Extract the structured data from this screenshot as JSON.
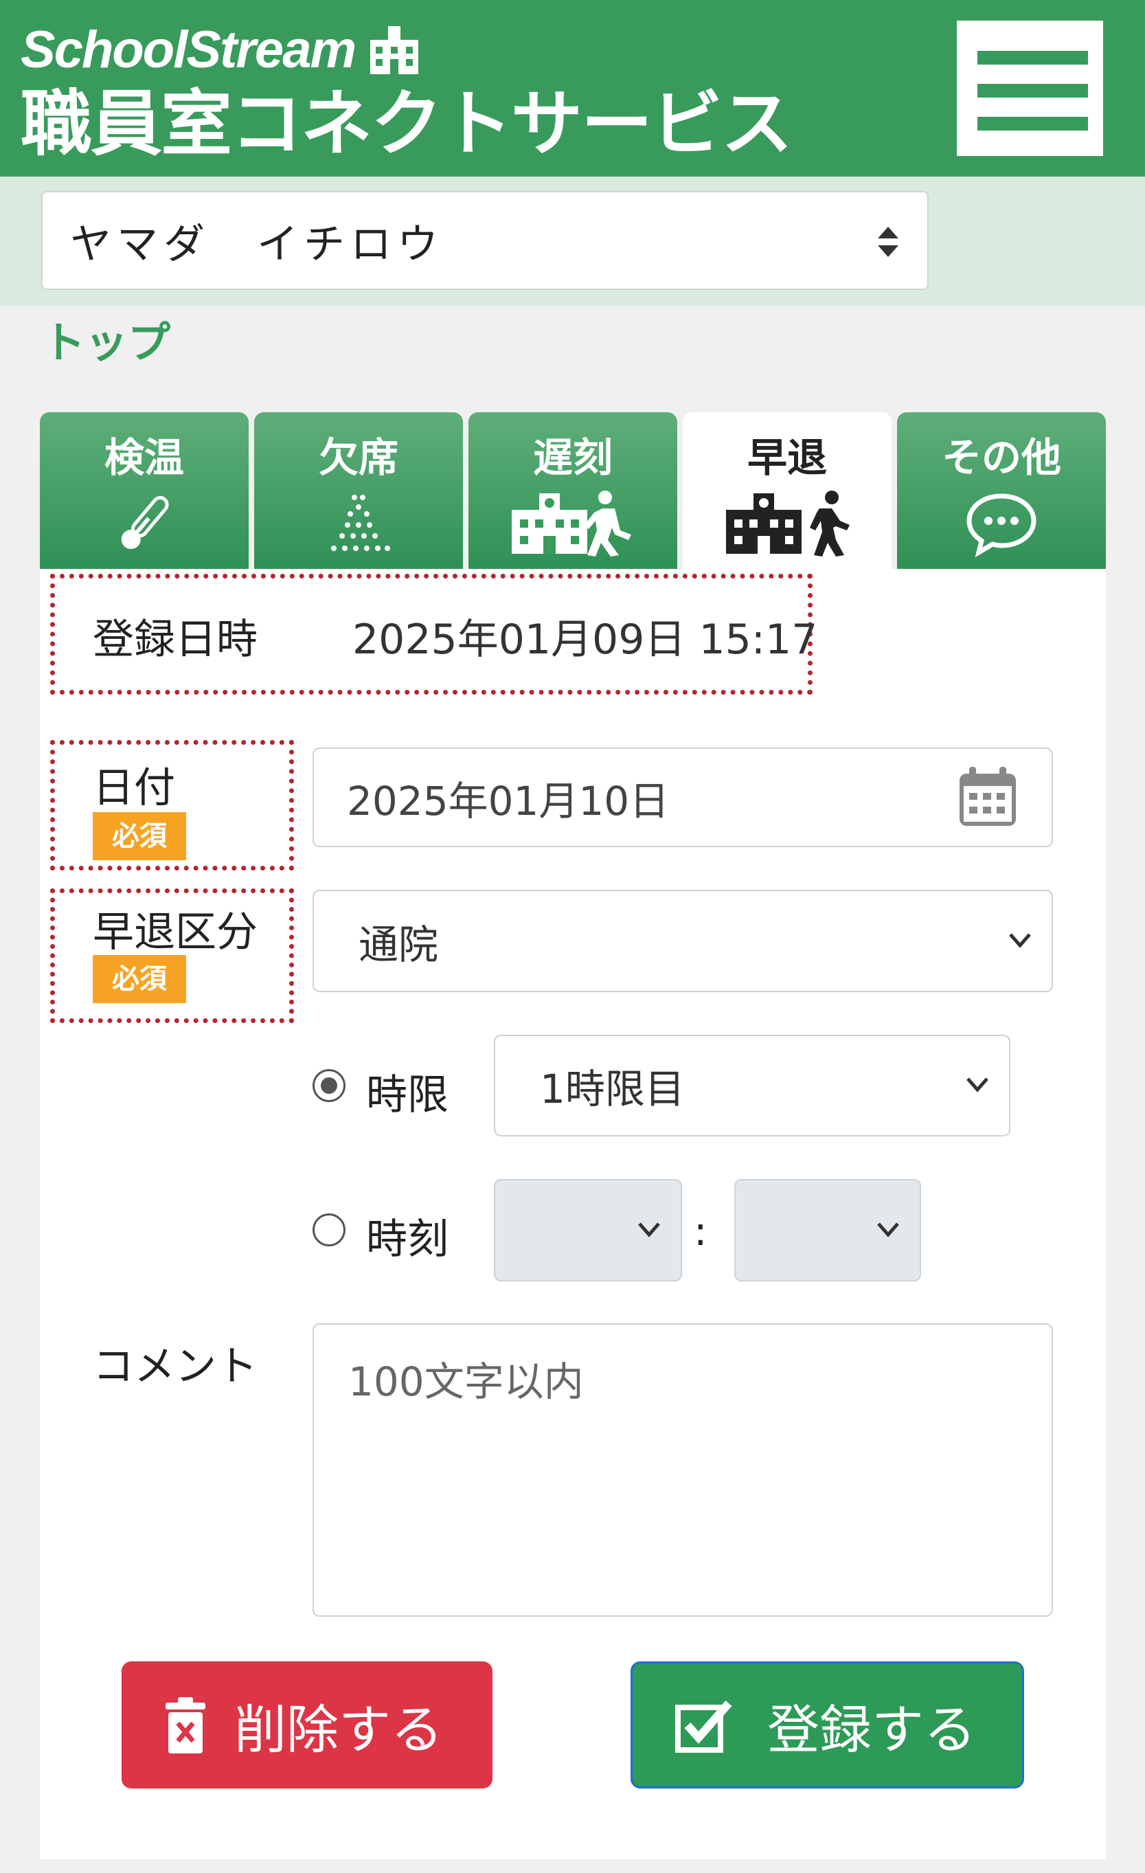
{
  "header": {
    "brand_line1": "SchoolStream",
    "brand_line2": "職員室コネクトサービス",
    "colors": {
      "brand_green": "#389b5c",
      "band_green": "#d9eadf"
    }
  },
  "student_select": {
    "value": "ヤマダ　イチロウ"
  },
  "breadcrumb": {
    "top": "トップ"
  },
  "tabs": [
    {
      "label": "検温",
      "icon": "thermometer-icon",
      "active": false
    },
    {
      "label": "欠席",
      "icon": "dots-icon",
      "active": false
    },
    {
      "label": "遅刻",
      "icon": "school-walk-in-icon",
      "active": false
    },
    {
      "label": "早退",
      "icon": "school-walk-out-icon",
      "active": true
    },
    {
      "label": "その他",
      "icon": "chat-icon",
      "active": false
    }
  ],
  "form": {
    "registered_label": "登録日時",
    "registered_value": "2025年01月09日 15:17",
    "date_label": "日付",
    "required_badge": "必須",
    "date_value": "2025年01月10日",
    "type_label": "早退区分",
    "type_value": "通院",
    "period_radio_label": "時限",
    "period_value": "1時限目",
    "period_selected": true,
    "time_radio_label": "時刻",
    "time_colon": ":",
    "comment_label": "コメント",
    "comment_placeholder": "100文字以内"
  },
  "actions": {
    "delete_label": "削除する",
    "submit_label": "登録する",
    "colors": {
      "delete": "#dc3545",
      "submit": "#2e9a57"
    }
  }
}
